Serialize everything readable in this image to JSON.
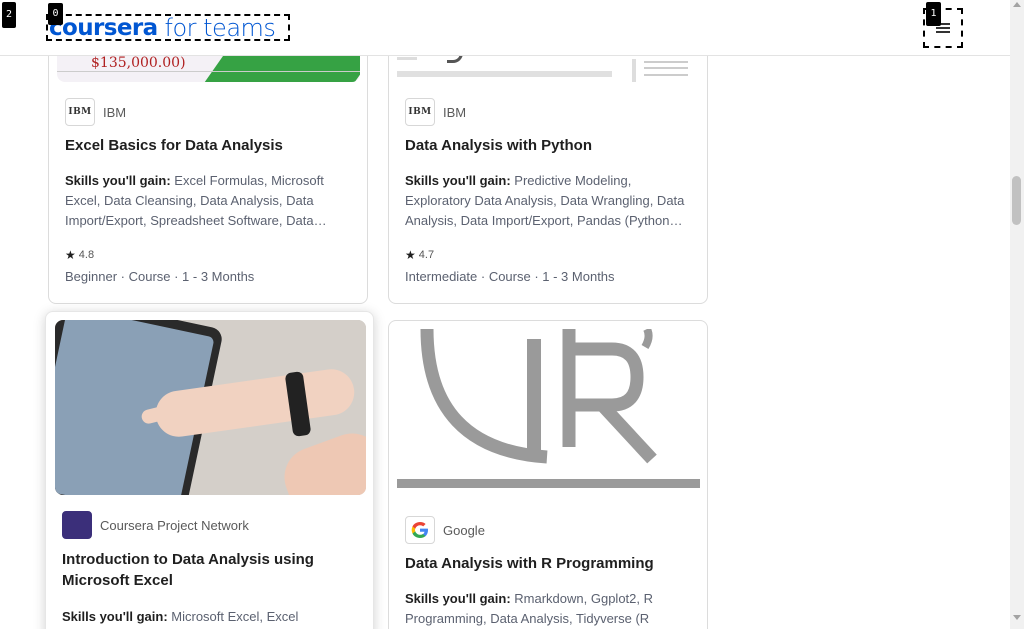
{
  "header": {
    "logo_brand": "coursera",
    "logo_suffix": "for teams",
    "menu_icon": "hamburger-menu-icon"
  },
  "overlay_tags": {
    "logo": "0",
    "menu": "1",
    "page": "2"
  },
  "cards": [
    {
      "partner": "IBM",
      "title": "Excel Basics for Data Analysis",
      "skills_label": "Skills you'll gain:",
      "skills": " Excel Formulas, Microsoft Excel, Data Cleansing, Data Analysis, Data Import/Export, Spreadsheet Software, Data…",
      "rating": "4.8",
      "meta": "Beginner · Course · 1 - 3 Months",
      "image_text": "$135,000.00)"
    },
    {
      "partner": "IBM",
      "title": "Data Analysis with Python",
      "skills_label": "Skills you'll gain:",
      "skills": " Predictive Modeling, Exploratory Data Analysis, Data Wrangling, Data Analysis, Data Import/Export, Pandas (Python…",
      "rating": "4.7",
      "meta": "Intermediate · Course · 1 - 3 Months"
    },
    {
      "partner": "Coursera Project Network",
      "title": "Introduction to Data Analysis using Microsoft Excel",
      "skills_label": "Skills you'll gain:",
      "skills": " Microsoft Excel, Excel"
    },
    {
      "partner": "Google",
      "title": "Data Analysis with R Programming",
      "skills_label": "Skills you'll gain:",
      "skills": " Rmarkdown, Ggplot2, R Programming, Data Analysis, Tidyverse (R"
    }
  ],
  "colors": {
    "brand": "#0056d2",
    "text": "#1f1f1f",
    "muted": "#5b6170"
  }
}
